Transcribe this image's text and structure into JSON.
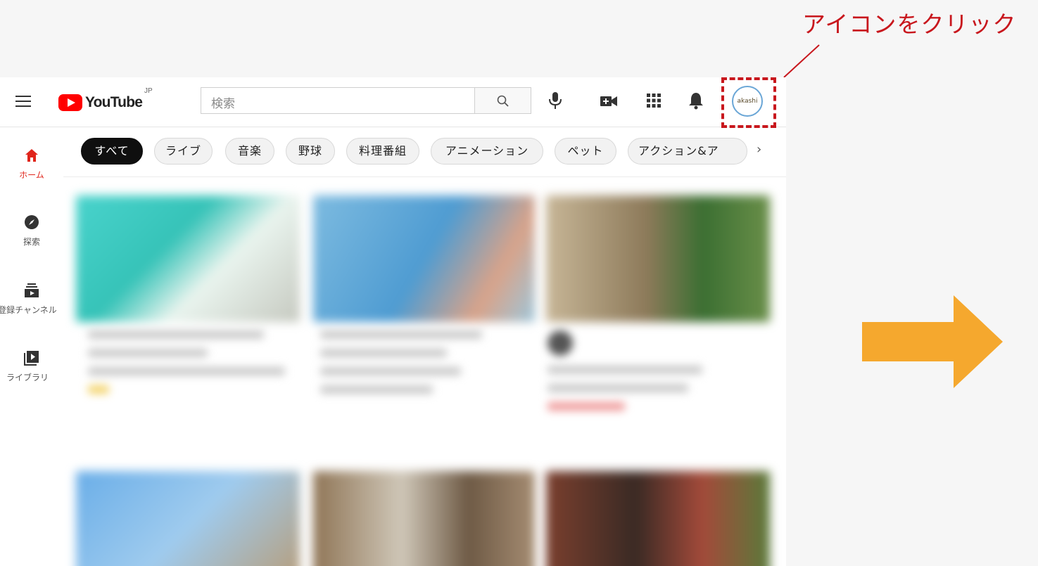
{
  "annotation": {
    "text": "アイコンをクリック",
    "color": "#c8171d"
  },
  "arrow": {
    "color": "#f5a82e",
    "icon": "arrow-right-icon"
  },
  "youtube": {
    "logo_text": "YouTube",
    "country": "JP",
    "search": {
      "placeholder": "検索"
    },
    "avatar_text": "akashi",
    "brand_color": "#ff0000"
  },
  "sidebar": {
    "items": [
      {
        "label": "ホーム",
        "icon": "home-icon",
        "active": true
      },
      {
        "label": "探索",
        "icon": "compass-icon"
      },
      {
        "label": "登録チャンネル",
        "icon": "subscriptions-icon"
      },
      {
        "label": "ライブラリ",
        "icon": "library-icon"
      }
    ]
  },
  "chips": [
    {
      "label": "すべて",
      "active": true
    },
    {
      "label": "ライブ"
    },
    {
      "label": "音楽"
    },
    {
      "label": "野球"
    },
    {
      "label": "料理番組"
    },
    {
      "label": "アニメーション"
    },
    {
      "label": "ペット"
    },
    {
      "label": "アクション&ア"
    }
  ]
}
